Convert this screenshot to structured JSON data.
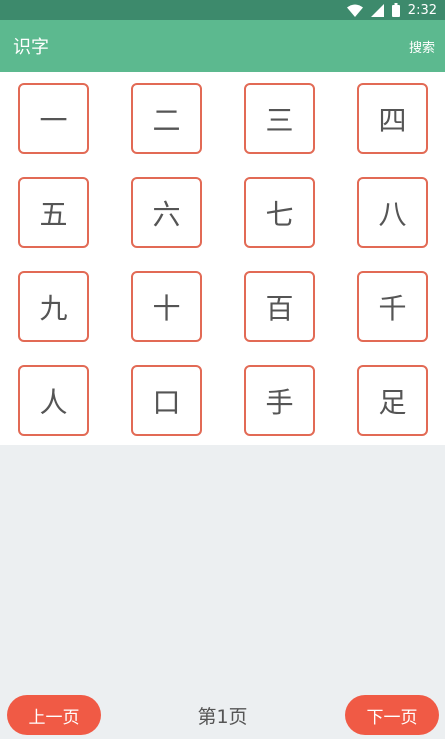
{
  "status_bar": {
    "time": "2:32",
    "icons": [
      "wifi-icon",
      "signal-icon",
      "battery-icon"
    ]
  },
  "app_bar": {
    "title": "识字",
    "search_label": "搜索"
  },
  "characters": [
    "一",
    "二",
    "三",
    "四",
    "五",
    "六",
    "七",
    "八",
    "九",
    "十",
    "百",
    "千",
    "人",
    "口",
    "手",
    "足"
  ],
  "footer": {
    "prev_label": "上一页",
    "page_label": "第1页",
    "next_label": "下一页"
  },
  "colors": {
    "status_bar": "#3d8a6c",
    "app_bar": "#5cb98f",
    "cell_border": "#e26a55",
    "button": "#f05a45",
    "background": "#eceff1"
  }
}
